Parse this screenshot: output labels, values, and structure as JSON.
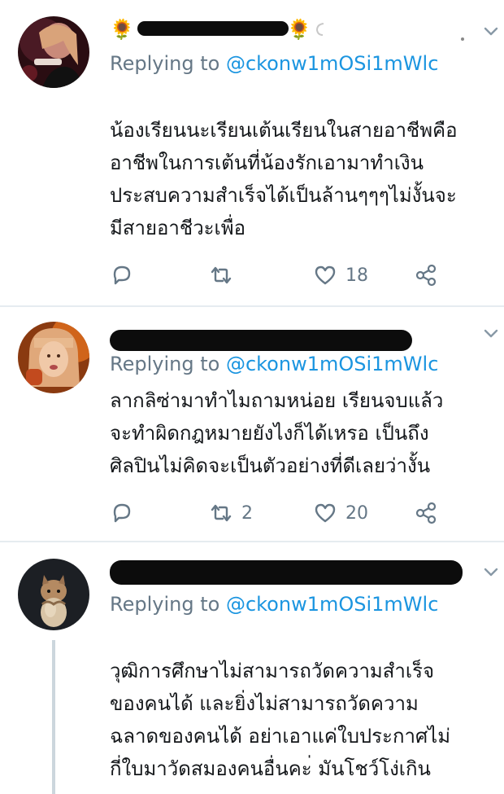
{
  "tweets": [
    {
      "replying_prefix": "Replying to ",
      "handle": "@ckonw1mOSi1mWlc",
      "lines": [
        "น้องเรียนนะเรียนเต้นเรียนในสายอาชีพคือ",
        "อาชีพในการเต้นที่น้องรักเอามาทำเงิน",
        "ประสบความสำเร็จได้เป็นล้านๆๆๆไม่งั้นจะ",
        "มีสายอาชีวะเพื่อ"
      ],
      "reply_count": "",
      "retweet_count": "",
      "like_count": "18"
    },
    {
      "replying_prefix": "Replying to ",
      "handle": "@ckonw1mOSi1mWlc",
      "lines": [
        "ลากลิซ่ามาทำไมถามหน่อย เรียนจบแล้ว",
        "จะทำผิดกฎหมายยังไงก็ได้เหรอ เป็นถึง",
        "ศิลปินไม่คิดจะเป็นตัวอย่างที่ดีเลยว่างั้น"
      ],
      "reply_count": "",
      "retweet_count": "2",
      "like_count": "20"
    },
    {
      "replying_prefix": "Replying to ",
      "handle": "@ckonw1mOSi1mWlc",
      "lines": [
        "วุฒิการศึกษาไม่สามารถวัดความสำเร็จ",
        "ของคนได้ และยิ่งไม่สามารถวัดความ",
        "ฉลาดของคนได้  อย่าเอาแค่ใบประกาศไม่",
        "กี่ใบมาวัดสมองคนอื่นคะ่ มันโชว์โง่เกิน"
      ]
    }
  ],
  "icons": {
    "reply": "reply-icon",
    "retweet": "retweet-icon",
    "like": "heart-icon",
    "share": "share-icon",
    "caret": "chevron-down-icon",
    "name_decoration": "sunflower-icon"
  },
  "colors": {
    "handle_blue": "#1b95e0",
    "meta_gray": "#657786",
    "text": "#14171a",
    "divider": "#e6ecf0"
  }
}
